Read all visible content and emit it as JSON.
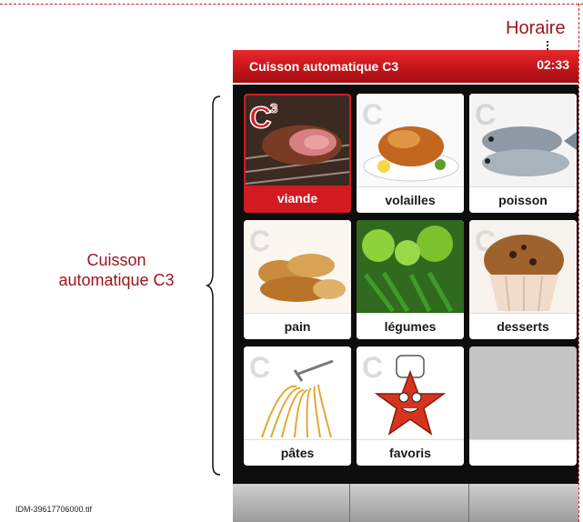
{
  "annotations": {
    "horaire": "Horaire",
    "cuisson_line1": "Cuisson",
    "cuisson_line2": "automatique C3",
    "footnote": "IDM-39617706000.tif"
  },
  "screen": {
    "title": "Cuisson automatique C3",
    "clock": "02:33"
  },
  "tiles": [
    {
      "label": "viande",
      "icon": "meat-icon",
      "active": true
    },
    {
      "label": "volailles",
      "icon": "roast-chicken-icon",
      "active": false
    },
    {
      "label": "poisson",
      "icon": "fish-icon",
      "active": false
    },
    {
      "label": "pain",
      "icon": "bread-icon",
      "active": false
    },
    {
      "label": "légumes",
      "icon": "vegetables-icon",
      "active": false
    },
    {
      "label": "desserts",
      "icon": "muffin-icon",
      "active": false
    },
    {
      "label": "pâtes",
      "icon": "pasta-fork-icon",
      "active": false
    },
    {
      "label": "favoris",
      "icon": "chef-star-icon",
      "active": false
    },
    {
      "label": "",
      "icon": "",
      "active": false
    }
  ],
  "bottom_buttons": [
    "",
    "",
    ""
  ],
  "colors": {
    "accent": "#d21a22",
    "annotation": "#a0141e",
    "screen_bg": "#0d0d0d"
  }
}
